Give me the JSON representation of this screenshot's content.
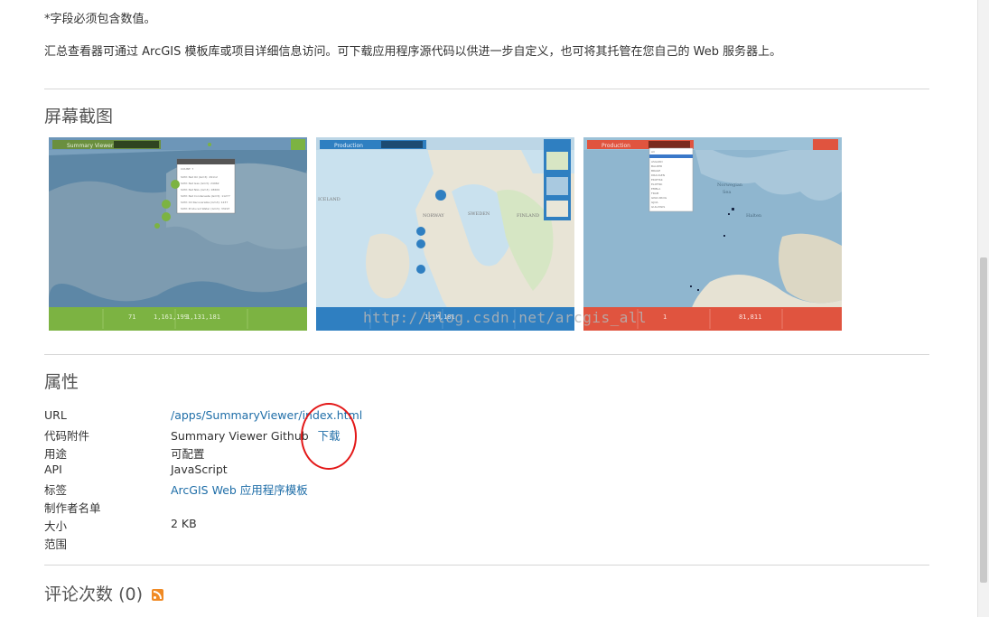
{
  "top": {
    "note": "*字段必须包含数值。",
    "description": "汇总查看器可通过 ArcGIS 模板库或项目详细信息访问。可下载应用程序源代码以供进一步自定义，也可将其托管在您自己的 Web 服务器上。"
  },
  "screenshots": {
    "heading": "屏幕截图",
    "items": [
      {
        "title": "Summary Viewer",
        "theme": "#7cb342"
      },
      {
        "title": "Production",
        "theme": "#2f7fc1"
      },
      {
        "title": "Production",
        "theme": "#e0543f"
      }
    ]
  },
  "watermark": "http://blog.csdn.net/arcgis_all",
  "properties": {
    "heading": "属性",
    "rows": [
      {
        "label": "URL",
        "value": "/apps/SummaryViewer/index.html"
      },
      {
        "label": "代码附件",
        "value": "Summary Viewer Github",
        "extra": "下载"
      },
      {
        "label": "用途",
        "value": "可配置"
      },
      {
        "label": "API",
        "value": "JavaScript"
      },
      {
        "label": "标签",
        "value": "ArcGIS Web 应用程序模板"
      },
      {
        "label": "制作者名单",
        "value": ""
      },
      {
        "label": "大小",
        "value": "2 KB"
      },
      {
        "label": "范围",
        "value": ""
      }
    ]
  },
  "comments": {
    "heading": "评论次数",
    "count": "(0)"
  }
}
